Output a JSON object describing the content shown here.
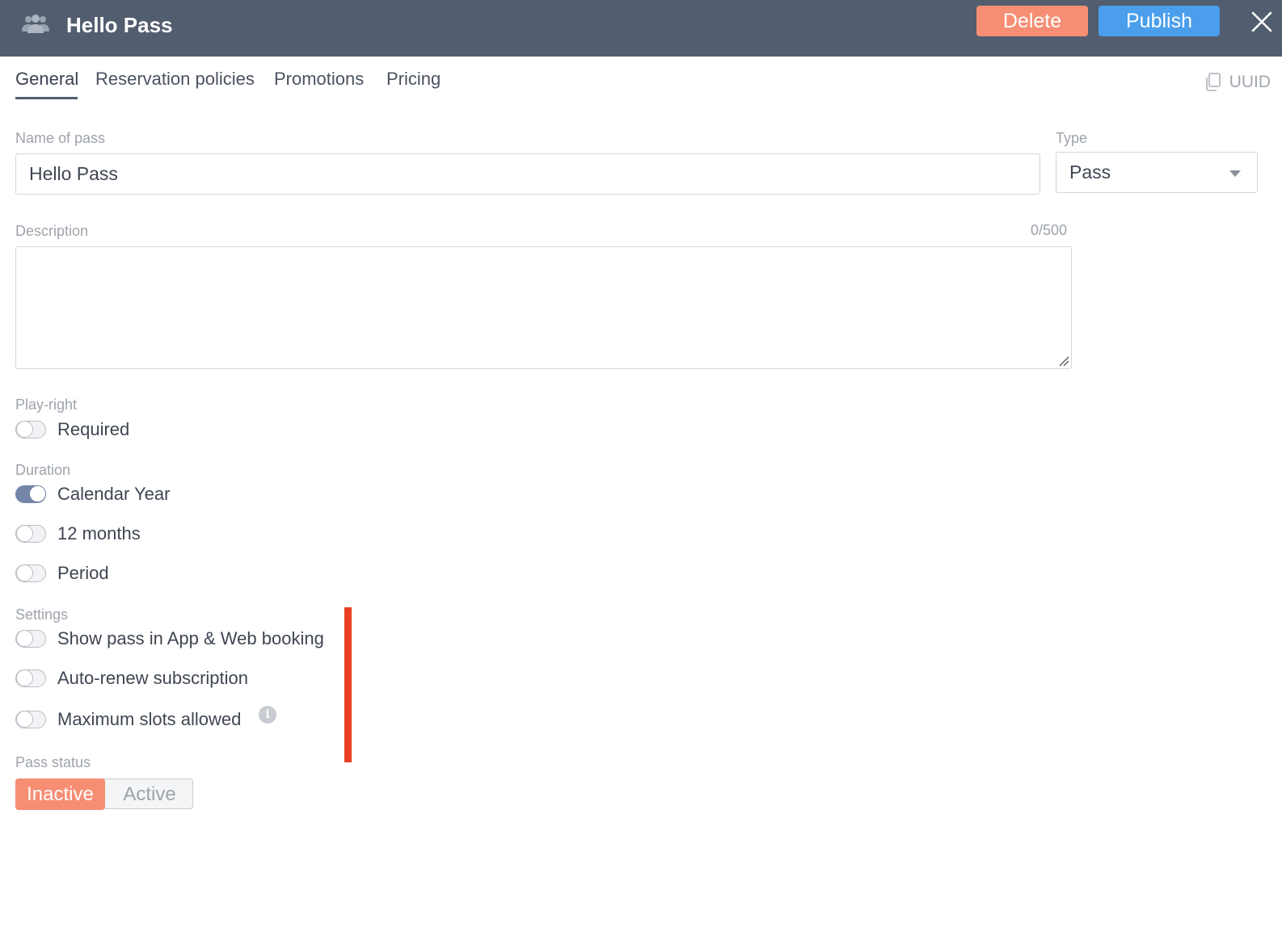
{
  "header": {
    "title": "Hello Pass",
    "delete_label": "Delete",
    "publish_label": "Publish",
    "icon": "people-icon",
    "colors": {
      "header_bg": "#525d6f",
      "delete": "#f68e74",
      "publish": "#4a9eec"
    }
  },
  "tabs": [
    {
      "label": "General",
      "active": true
    },
    {
      "label": "Reservation policies",
      "active": false
    },
    {
      "label": "Promotions",
      "active": false
    },
    {
      "label": "Pricing",
      "active": false
    }
  ],
  "uuid_label": "UUID",
  "form": {
    "name_label": "Name of pass",
    "name_value": "Hello Pass",
    "type_label": "Type",
    "type_value": "Pass",
    "description_label": "Description",
    "description_counter": "0/500",
    "description_value": ""
  },
  "play_right": {
    "label": "Play-right",
    "options": [
      {
        "label": "Required",
        "on": false
      }
    ]
  },
  "duration": {
    "label": "Duration",
    "options": [
      {
        "label": "Calendar Year",
        "on": true
      },
      {
        "label": "12 months",
        "on": false
      },
      {
        "label": "Period",
        "on": false
      }
    ]
  },
  "settings": {
    "label": "Settings",
    "options": [
      {
        "label": "Show pass in App & Web booking",
        "on": false
      },
      {
        "label": "Auto-renew subscription",
        "on": false
      },
      {
        "label": "Maximum slots allowed",
        "on": false
      }
    ]
  },
  "pass_status": {
    "label": "Pass status",
    "inactive_label": "Inactive",
    "active_label": "Active",
    "selected": "Inactive"
  },
  "accent_colors": {
    "toggle_on": "#7486a8",
    "marker": "#ea3f23"
  }
}
